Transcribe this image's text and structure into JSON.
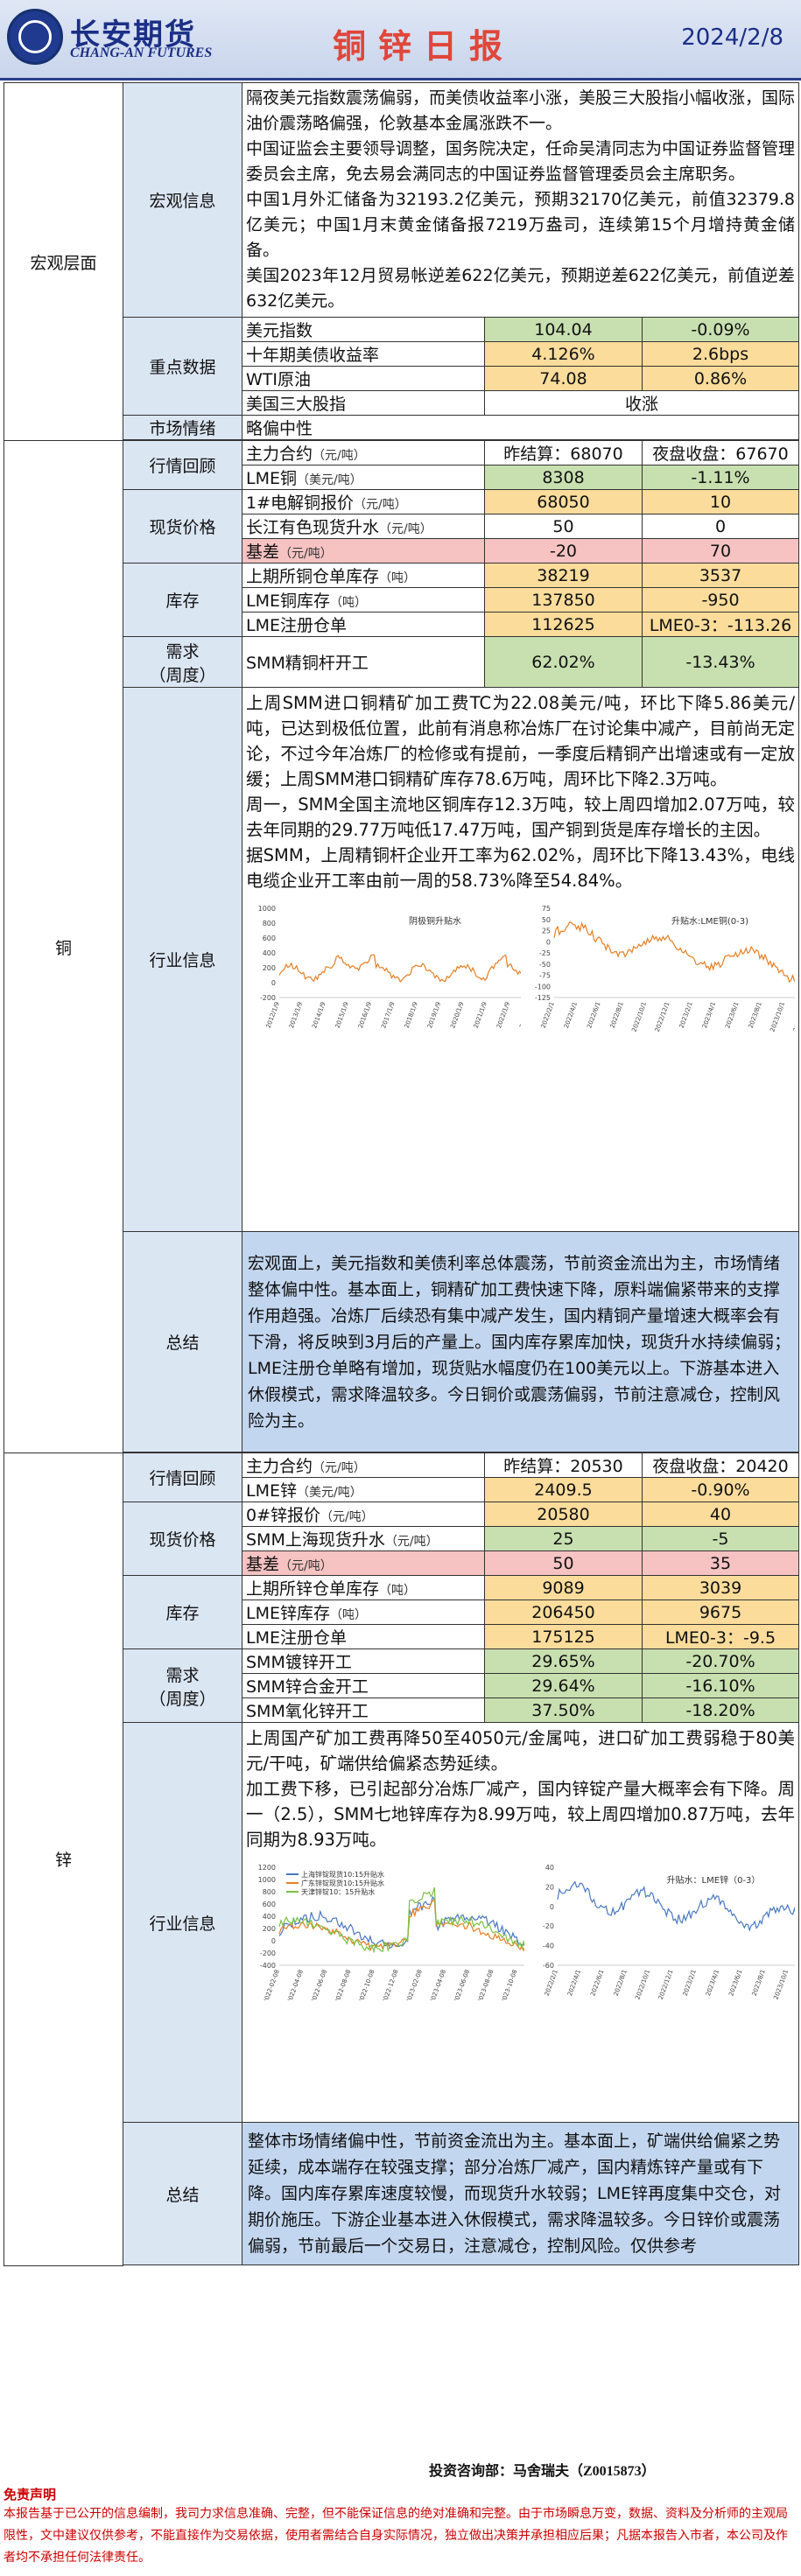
{
  "header": {
    "brand_cn": "长安期货",
    "brand_en": "CHANG-AN FUTURES",
    "title": "铜锌日报",
    "date": "2024/2/8"
  },
  "macro": {
    "section": "宏观层面",
    "info_label": "宏观信息",
    "info": "隔夜美元指数震荡偏弱，而美债收益率小涨，美股三大股指小幅收涨，国际油价震荡略偏强，伦敦基本金属涨跌不一。\n中国证监会主要领导调整，国务院决定，任命吴清同志为中国证券监督管理委员会主席，免去易会满同志的中国证券监督管理委员会主席职务。\n中国1月外汇储备为32193.2亿美元，预期32170亿美元，前值32379.8亿美元；中国1月末黄金储备报7219万盎司，连续第15个月增持黄金储备。\n美国2023年12月贸易帐逆差622亿美元，预期逆差622亿美元，前值逆差632亿美元。",
    "key_label": "重点数据",
    "key": [
      {
        "name": "美元指数",
        "v1": "104.04",
        "v2": "-0.09%"
      },
      {
        "name": "十年期美债收益率",
        "v1": "4.126%",
        "v2": "2.6bps"
      },
      {
        "name": "WTI原油",
        "v1": "74.08",
        "v2": "0.86%"
      },
      {
        "name": "美国三大股指",
        "v1": "收涨",
        "v2": ""
      }
    ],
    "mood_label": "市场情绪",
    "mood": "略偏中性"
  },
  "copper": {
    "section": "铜",
    "review_label": "行情回顾",
    "main": {
      "name": "主力合约",
      "unit": "（元/吨）",
      "settle": "昨结算：68070",
      "night": "夜盘收盘：67670"
    },
    "lme": {
      "name": "LME铜",
      "unit": "（美元/吨）",
      "v1": "8308",
      "v2": "-1.11%"
    },
    "spot_label": "现货价格",
    "spot": [
      {
        "name": "1#电解铜报价",
        "unit": "（元/吨）",
        "v1": "68050",
        "v2": "10"
      },
      {
        "name": "长江有色现货升水",
        "unit": "（元/吨）",
        "v1": "50",
        "v2": "0"
      },
      {
        "name": "基差",
        "unit": "（元/吨）",
        "v1": "-20",
        "v2": "70"
      }
    ],
    "stock_label": "库存",
    "stock": [
      {
        "name": "上期所铜仓单库存",
        "unit": "（吨）",
        "v1": "38219",
        "v2": "3537"
      },
      {
        "name": "LME铜库存",
        "unit": "（吨）",
        "v1": "137850",
        "v2": "-950"
      },
      {
        "name": "LME注册仓单",
        "unit": "",
        "v1": "112625",
        "v2": "LME0-3：-113.26"
      }
    ],
    "demand_label": "需求\n（周度）",
    "demand": [
      {
        "name": "SMM精铜杆开工",
        "v1": "62.02%",
        "v2": "-13.43%"
      }
    ],
    "industry_label": "行业信息",
    "industry": "上周SMM进口铜精矿加工费TC为22.08美元/吨，环比下降5.86美元/吨，已达到极低位置，此前有消息称冶炼厂在讨论集中减产，目前尚无定论，不过今年冶炼厂的检修或有提前，一季度后精铜产出增速或有一定放缓；上周SMM港口铜精矿库存78.6万吨，周环比下降2.3万吨。\n周一，SMM全国主流地区铜库存12.3万吨，较上周四增加2.07万吨，较去年同期的29.77万吨低17.47万吨，国产铜到货是库存增长的主因。\n据SMM，上周精铜杆企业开工率为62.02%，周环比下降13.43%，电线电缆企业开工率由前一周的58.73%降至54.84%。",
    "chart1": {
      "title": "阴极铜升贴水",
      "yticks": [
        "1000",
        "800",
        "600",
        "400",
        "200",
        "0",
        "-200"
      ],
      "xticks": [
        "2012/1/9",
        "2013/1/9",
        "2014/1/9",
        "2015/1/9",
        "2016/1/9",
        "2017/1/9",
        "2018/1/9",
        "2019/1/9",
        "2020/1/9",
        "2021/1/9",
        "2022/1/9",
        "2023/1/9",
        "2024/1/9"
      ]
    },
    "chart2": {
      "title": "升贴水:LME铜(0-3)",
      "yticks": [
        "75",
        "50",
        "25",
        "0",
        "-25",
        "-50",
        "-75",
        "-100",
        "-125"
      ],
      "xticks": [
        "2022/2/1",
        "2022/4/1",
        "2022/6/1",
        "2022/8/1",
        "2022/10/1",
        "2022/12/1",
        "2023/2/1",
        "2023/4/1",
        "2023/6/1",
        "2023/8/1",
        "2023/10/1",
        "2023/12/1",
        "2024/2/1"
      ]
    },
    "summary_label": "总结",
    "summary": "宏观面上，美元指数和美债利率总体震荡，节前资金流出为主，市场情绪整体偏中性。基本面上，铜精矿加工费快速下降，原料端偏紧带来的支撑作用趋强。冶炼厂后续恐有集中减产发生，国内精铜产量增速大概率会有下滑，将反映到3月后的产量上。国内库存累库加快，现货升水持续偏弱；LME注册仓单略有增加，现货贴水幅度仍在100美元以上。下游基本进入休假模式，需求降温较多。今日铜价或震荡偏弱，节前注意减仓，控制风险为主。"
  },
  "zinc": {
    "section": "锌",
    "review_label": "行情回顾",
    "main": {
      "name": "主力合约",
      "unit": "（元/吨）",
      "settle": "昨结算：20530",
      "night": "夜盘收盘：20420"
    },
    "lme": {
      "name": "LME锌",
      "unit": "（美元/吨）",
      "v1": "2409.5",
      "v2": "-0.90%"
    },
    "spot_label": "现货价格",
    "spot": [
      {
        "name": "0#锌报价",
        "unit": "（元/吨）",
        "v1": "20580",
        "v2": "40"
      },
      {
        "name": "SMM上海现货升水",
        "unit": "（元/吨）",
        "v1": "25",
        "v2": "-5"
      },
      {
        "name": "基差",
        "unit": "（元/吨）",
        "v1": "50",
        "v2": "35"
      }
    ],
    "stock_label": "库存",
    "stock": [
      {
        "name": "上期所锌仓单库存",
        "unit": "（吨）",
        "v1": "9089",
        "v2": "3039"
      },
      {
        "name": "LME锌库存",
        "unit": "（吨）",
        "v1": "206450",
        "v2": "9675"
      },
      {
        "name": "LME注册仓单",
        "unit": "",
        "v1": "175125",
        "v2": "LME0-3：-9.5"
      }
    ],
    "demand_label": "需求\n（周度）",
    "demand": [
      {
        "name": "SMM镀锌开工",
        "v1": "29.65%",
        "v2": "-20.70%"
      },
      {
        "name": "SMM锌合金开工",
        "v1": "29.64%",
        "v2": "-16.10%"
      },
      {
        "name": "SMM氧化锌开工",
        "v1": "37.50%",
        "v2": "-18.20%"
      }
    ],
    "industry_label": "行业信息",
    "industry": "上周国产矿加工费再降50至4050元/金属吨，进口矿加工费弱稳于80美元/干吨，矿端供给偏紧态势延续。\n加工费下移，已引起部分冶炼厂减产，国内锌锭产量大概率会有下降。周一（2.5），SMM七地锌库存为8.99万吨，较上周四增加0.87万吨，去年同期为8.93万吨。",
    "chart3": {
      "legend": [
        "上海锌锭现货10:15升贴水",
        "广东锌锭现货10:15升贴水",
        "天津锌锭10：15升贴水"
      ],
      "yticks": [
        "1200",
        "1000",
        "800",
        "600",
        "400",
        "200",
        "0",
        "-200",
        "-400"
      ],
      "xticks": [
        "2022-02-08",
        "2022-04-08",
        "2022-06-08",
        "2022-08-08",
        "2022-10-08",
        "2022-12-08",
        "2023-02-08",
        "2023-04-08",
        "2023-06-08",
        "2023-08-08",
        "2023-10-08",
        "2023-12-08",
        "2024-02-08"
      ]
    },
    "chart4": {
      "title": "升贴水：LME锌（0-3）",
      "yticks": [
        "40",
        "20",
        "0",
        "-20",
        "-40",
        "-60"
      ],
      "xticks": [
        "2022/2/1",
        "2022/4/1",
        "2022/6/1",
        "2022/8/1",
        "2022/10/1",
        "2022/12/1",
        "2023/2/1",
        "2023/4/1",
        "2023/6/1",
        "2023/8/1",
        "2023/10/1",
        "2023/12/1",
        "2024/2/1"
      ]
    },
    "summary_label": "总结",
    "summary": "整体市场情绪偏中性，节前资金流出为主。基本面上，矿端供给偏紧之势延续，成本端存在较强支撑；部分冶炼厂减产，国内精炼锌产量或有下降。国内库存累库速度较慢，而现货升水较弱；LME锌再度集中交仓，对期价施压。下游企业基本进入休假模式，需求降温较多。今日锌价或震荡偏弱，节前最后一个交易日，注意减仓，控制风险。仅供参考"
  },
  "footer": {
    "consult": "投资咨询部：马舍瑞夫（Z0015873）",
    "disclaimer_head": "免责声明",
    "disclaimer": "本报告基于已公开的信息编制，我司力求信息准确、完整，但不能保证信息的绝对准确和完整。由于市场瞬息万变，数据、资料及分析师的主观局限性，文中建议仅供参考，不能直接作为交易依据，使用者需结合自身实际情况，独立做出决策并承担相应后果；凡据本报告入市者，本公司及作者均不承担任何法律责任。"
  }
}
